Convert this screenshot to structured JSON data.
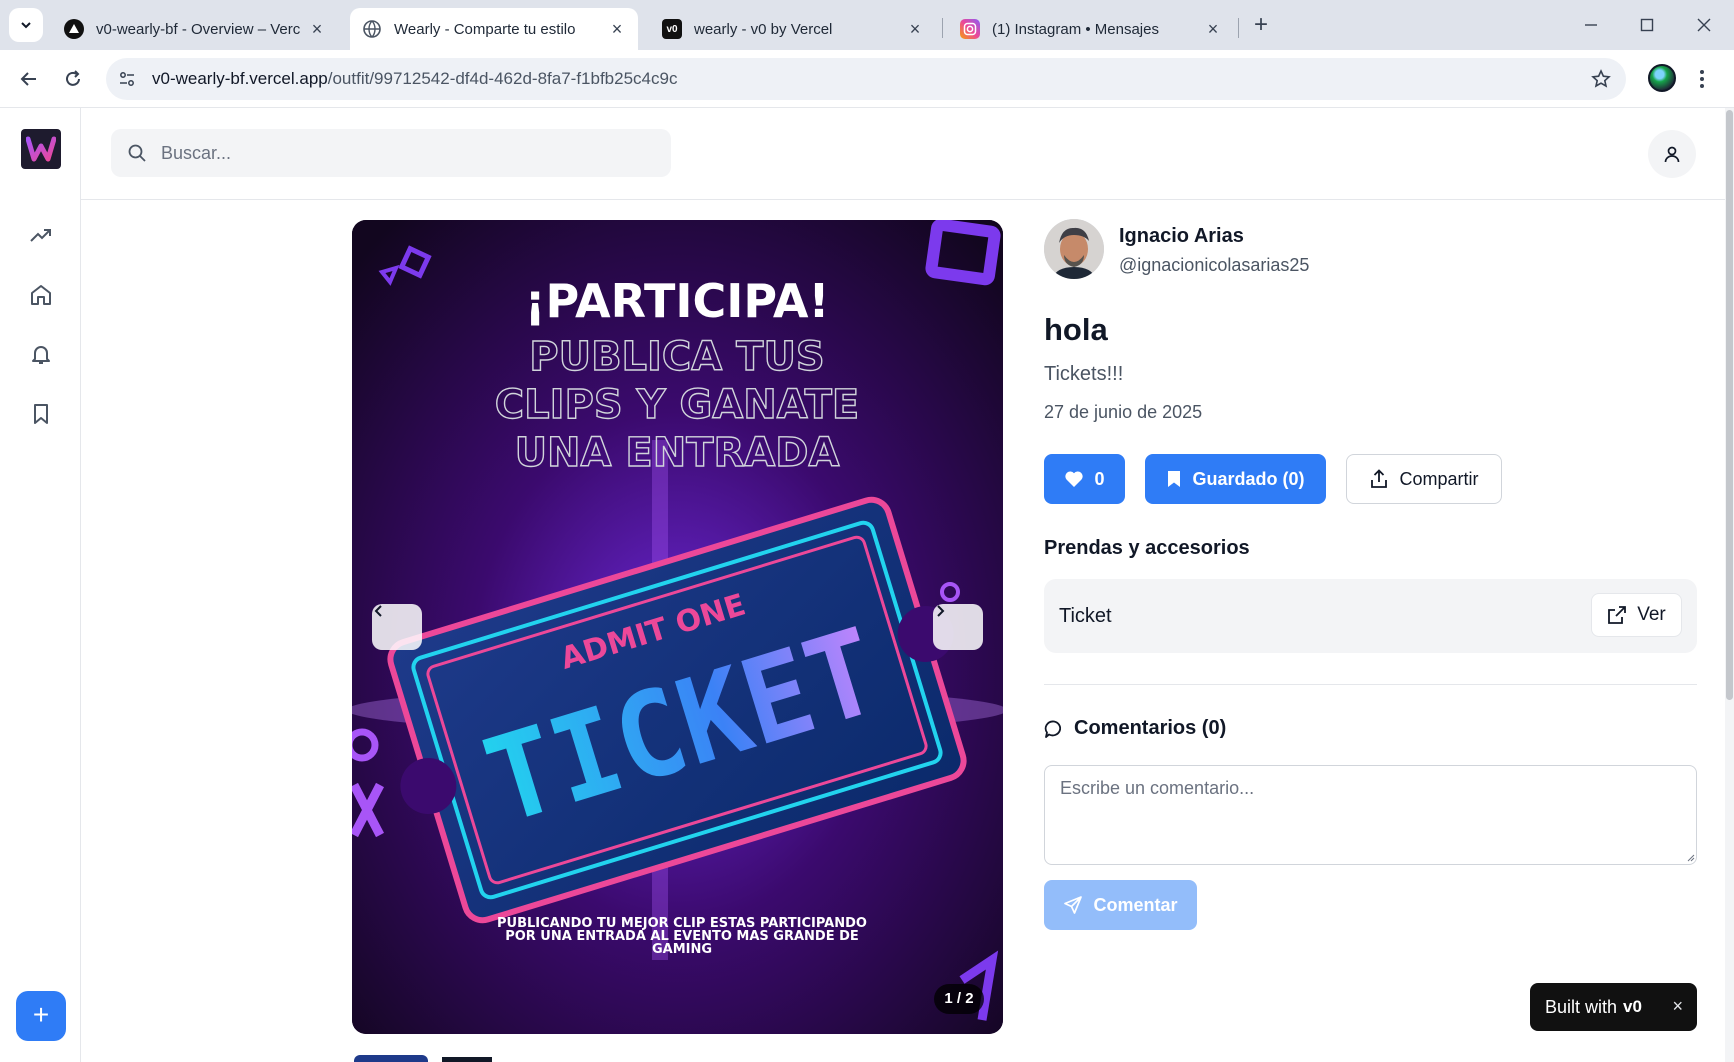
{
  "browser": {
    "tabs": [
      {
        "title": "v0-wearly-bf - Overview – Vercel",
        "active": false,
        "icon": "vercel-triangle-icon"
      },
      {
        "title": "Wearly - Comparte tu estilo",
        "active": true,
        "icon": "globe-icon"
      },
      {
        "title": "wearly - v0 by Vercel",
        "active": false,
        "icon": "v0-icon"
      },
      {
        "title": "(1) Instagram • Mensajes",
        "active": false,
        "icon": "instagram-icon"
      }
    ],
    "url_host": "v0-wearly-bf.vercel.app",
    "url_path": "/outfit/99712542-df4d-462d-8fa7-f1bfb25c4c9c"
  },
  "header": {
    "search_placeholder": "Buscar..."
  },
  "post": {
    "image": {
      "headline": "¡PARTICIPA!",
      "outline_lines": [
        "PUBLICA TUS",
        "CLIPS Y GANATE",
        "UNA ENTRADA"
      ],
      "ticket_top": "ADMIT ONE",
      "ticket_main": "TICKET",
      "footer_lines": [
        "PUBLICANDO TU MEJOR CLIP ESTAS PARTICIPANDO",
        "POR UNA ENTRADA AL EVENTO MAS GRANDE DE",
        "GAMING"
      ],
      "counter": "1 / 2"
    },
    "author": {
      "name": "Ignacio Arias",
      "handle": "@ignacionicolasarias25"
    },
    "title": "hola",
    "description": "Tickets!!!",
    "date": "27 de junio de 2025",
    "actions": {
      "likes": "0",
      "saved_label": "Guardado (0)",
      "share_label": "Compartir"
    },
    "items_section_title": "Prendas y accesorios",
    "items": [
      {
        "name": "Ticket",
        "view_label": "Ver"
      }
    ],
    "comments": {
      "title": "Comentarios (0)",
      "placeholder": "Escribe un comentario...",
      "submit_label": "Comentar"
    }
  },
  "badge": {
    "built_with": "Built with",
    "brand": "v0"
  },
  "colors": {
    "accent": "#2f7cf6",
    "accent_disabled": "#93bdfa",
    "neon_pink": "#ec4899",
    "neon_cyan": "#22d3ee"
  }
}
